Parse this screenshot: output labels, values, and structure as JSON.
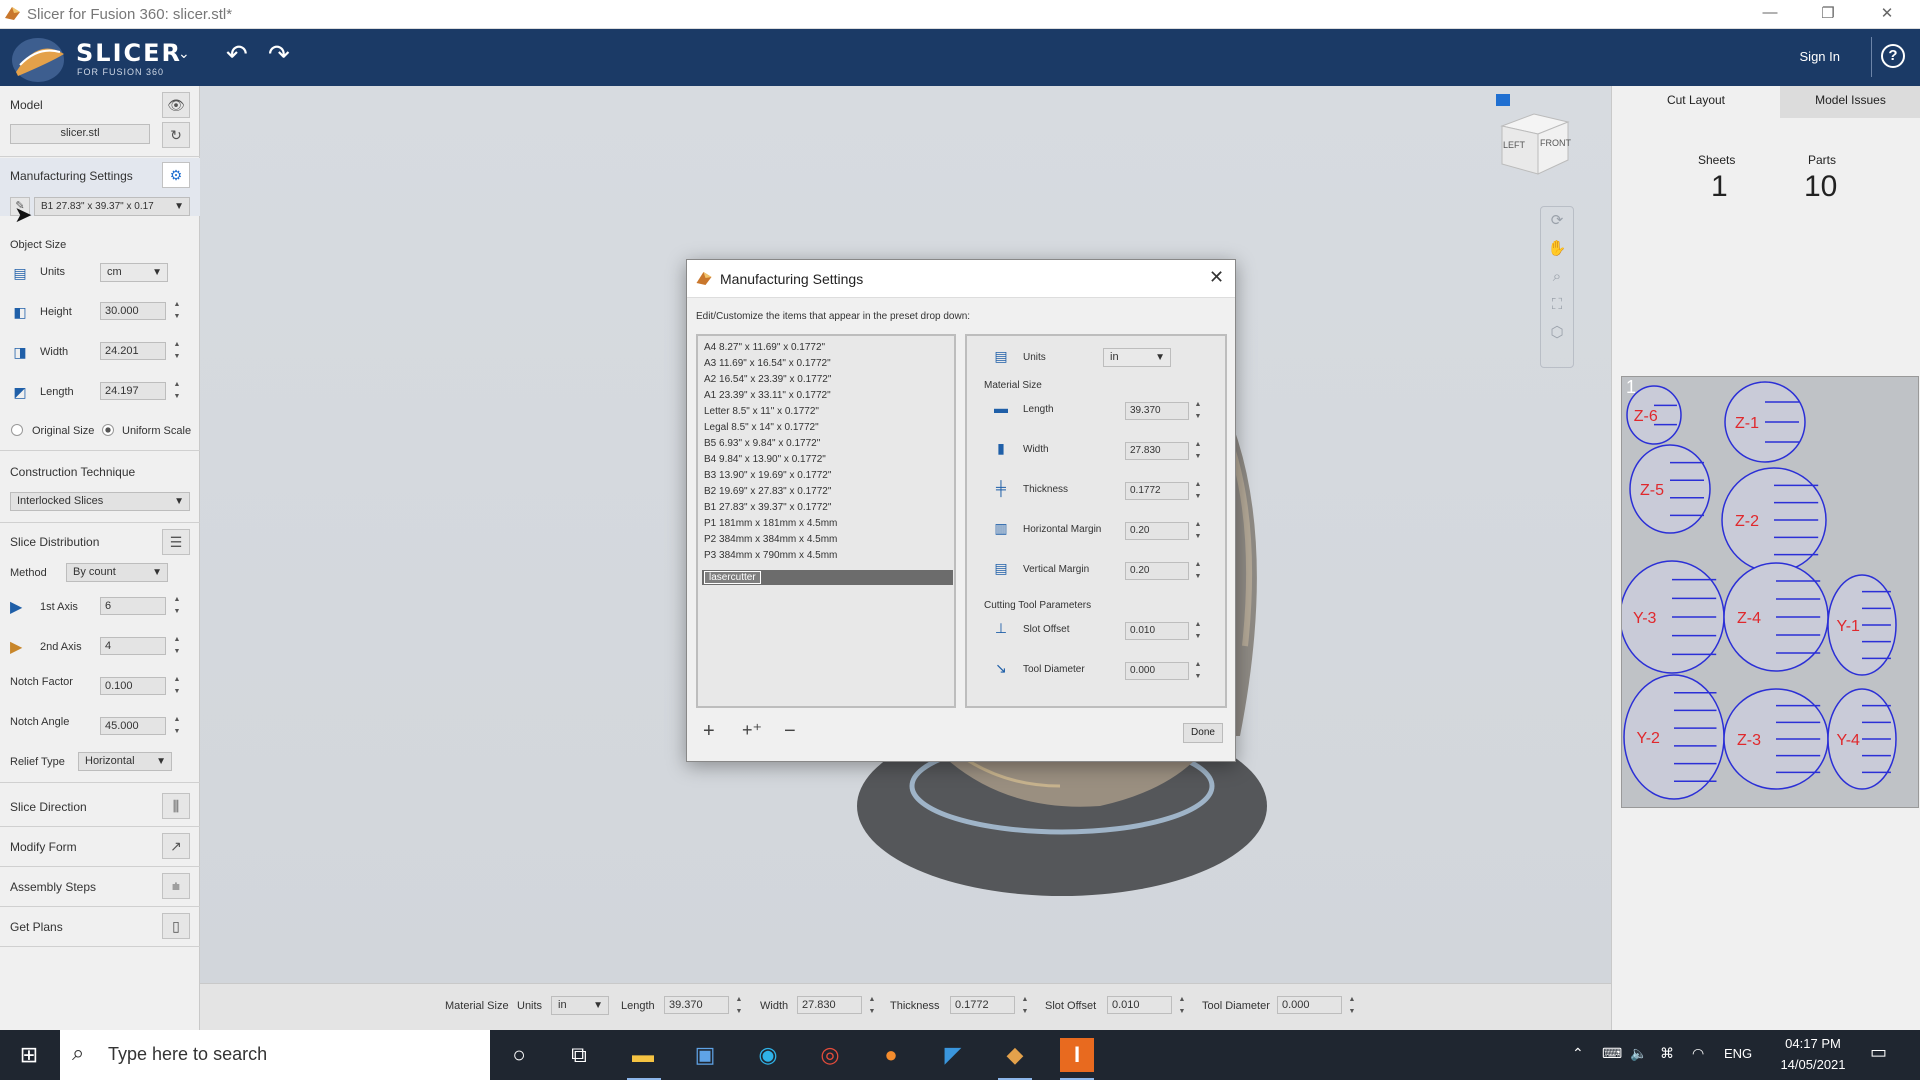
{
  "window": {
    "title": "Slicer for Fusion 360: slicer.stl*",
    "min": "—",
    "max": "❐",
    "close": "✕"
  },
  "header": {
    "brand": "SLICER",
    "brand_sub": "FOR FUSION 360",
    "sign_in": "Sign In",
    "help": "?",
    "undo": "↶",
    "redo": "↷"
  },
  "left": {
    "model_label": "Model",
    "model_file": "slicer.stl",
    "manufacturing_label": "Manufacturing Settings",
    "preset": "B1 27.83\" x 39.37\" x 0.17",
    "object_size": "Object Size",
    "units_label": "Units",
    "units_value": "cm",
    "height_label": "Height",
    "height": "30.000",
    "width_label": "Width",
    "width": "24.201",
    "length_label": "Length",
    "length": "24.197",
    "original_size": "Original Size",
    "uniform_scale": "Uniform Scale",
    "construction_label": "Construction Technique",
    "construction_value": "Interlocked Slices",
    "slice_distribution": "Slice Distribution",
    "method_label": "Method",
    "method_value": "By count",
    "axis1_label": "1st Axis",
    "axis1": "6",
    "axis2_label": "2nd Axis",
    "axis2": "4",
    "notch_factor_label": "Notch Factor",
    "notch_factor": "0.100",
    "notch_angle_label": "Notch Angle",
    "notch_angle": "45.000",
    "relief_label": "Relief Type",
    "relief_value": "Horizontal",
    "slice_direction": "Slice Direction",
    "modify_form": "Modify Form",
    "assembly_steps": "Assembly Steps",
    "get_plans": "Get Plans"
  },
  "viewcube": {
    "left": "LEFT",
    "front": "FRONT"
  },
  "right": {
    "tab_cut": "Cut Layout",
    "tab_issues": "Model Issues",
    "sheets_label": "Sheets",
    "sheets": "1",
    "parts_label": "Parts",
    "parts": "10",
    "sheet_number": "1",
    "parts_list": [
      "Z-6",
      "Z-1",
      "Z-5",
      "Z-2",
      "Y-3",
      "Z-4",
      "Y-1",
      "Y-2",
      "Z-3",
      "Y-4"
    ]
  },
  "bottom": {
    "material_size": "Material Size",
    "units": "Units",
    "units_value": "in",
    "length": "Length",
    "length_value": "39.370",
    "width": "Width",
    "width_value": "27.830",
    "thickness": "Thickness",
    "thickness_value": "0.1772",
    "slot_offset": "Slot Offset",
    "slot_offset_value": "0.010",
    "tool_diameter": "Tool Diameter",
    "tool_diameter_value": "0.000"
  },
  "dialog": {
    "title": "Manufacturing Settings",
    "hint": "Edit/Customize the items that appear in the preset drop down:",
    "presets": [
      "A4 8.27\" x 11.69\" x 0.1772\"",
      "A3 11.69\" x 16.54\" x 0.1772\"",
      "A2 16.54\" x 23.39\" x 0.1772\"",
      "A1 23.39\" x 33.11\" x 0.1772\"",
      "Letter 8.5\" x 11\" x 0.1772\"",
      "Legal 8.5\" x 14\" x 0.1772\"",
      "B5 6.93\" x 9.84\" x 0.1772\"",
      "B4 9.84\" x 13.90\" x 0.1772\"",
      "B3 13.90\" x 19.69\" x 0.1772\"",
      "B2 19.69\" x 27.83\" x 0.1772\"",
      "B1 27.83\" x 39.37\" x 0.1772\"",
      "P1 181mm x 181mm x 4.5mm",
      "P2 384mm x 384mm x 4.5mm",
      "P3 384mm x 790mm x 4.5mm"
    ],
    "selected_preset": "lasercutter",
    "units_label": "Units",
    "units_value": "in",
    "material_size": "Material Size",
    "length_label": "Length",
    "length": "39.370",
    "width_label": "Width",
    "width": "27.830",
    "thickness_label": "Thickness",
    "thickness": "0.1772",
    "hmargin_label": "Horizontal Margin",
    "hmargin": "0.20",
    "vmargin_label": "Vertical Margin",
    "vmargin": "0.20",
    "cutting_params": "Cutting Tool Parameters",
    "slot_offset_label": "Slot Offset",
    "slot_offset": "0.010",
    "tool_diameter_label": "Tool Diameter",
    "tool_diameter": "0.000",
    "add": "+",
    "add_copy": "+⁺",
    "remove": "−",
    "done": "Done"
  },
  "taskbar": {
    "search_placeholder": "Type here to search",
    "time": "04:17 PM",
    "date": "14/05/2021",
    "lang": "ENG"
  }
}
